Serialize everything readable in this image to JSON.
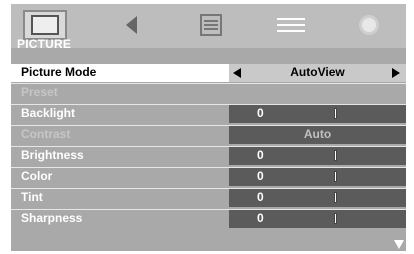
{
  "tabs": [
    {
      "name": "picture",
      "icon": "monitor-icon"
    },
    {
      "name": "audio",
      "icon": "speaker-icon"
    },
    {
      "name": "setup",
      "icon": "settings-box-icon"
    },
    {
      "name": "options",
      "icon": "lines-icon"
    },
    {
      "name": "eco",
      "icon": "sun-icon"
    }
  ],
  "section_title": "PICTURE",
  "rows": [
    {
      "label": "Picture Mode",
      "value": "AutoView"
    },
    {
      "label": "Preset"
    },
    {
      "label": "Backlight",
      "value": "0"
    },
    {
      "label": "Contrast",
      "value": "Auto"
    },
    {
      "label": "Brightness",
      "value": "0"
    },
    {
      "label": "Color",
      "value": "0"
    },
    {
      "label": "Tint",
      "value": "0"
    },
    {
      "label": "Sharpness",
      "value": "0"
    }
  ]
}
